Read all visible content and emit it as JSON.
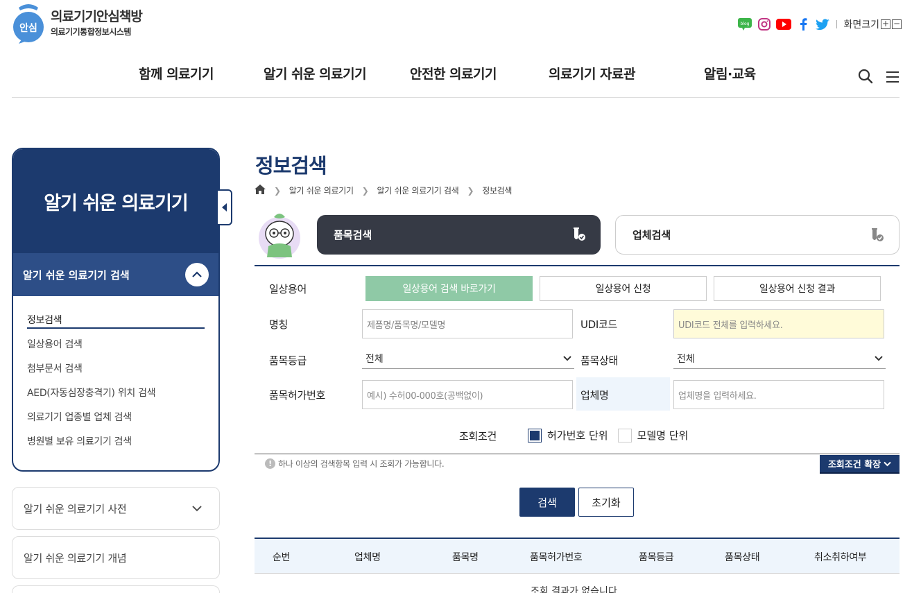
{
  "brand": {
    "title": "의료기기안심책방",
    "subtitle": "의료기기통합정보시스템",
    "logo_mark": "안심"
  },
  "social": {
    "blog_label": "blog",
    "font_size_label": "화면크기",
    "plus": "+",
    "minus": "−"
  },
  "gnb": [
    "함께 의료기기",
    "알기 쉬운 의료기기",
    "안전한 의료기기",
    "의료기기 자료관",
    "알림·교육"
  ],
  "sidebar": {
    "header": "알기 쉬운 의료기기",
    "section": "알기 쉬운 의료기기 검색",
    "items": [
      "정보검색",
      "일상용어 검색",
      "첨부문서 검색",
      "AED(자동심장충격기) 위치 검색",
      "의료기기 업종별 업체 검색",
      "병원별 보유 의료기기 검색"
    ],
    "accordions": [
      "알기 쉬운 의료기기 사전",
      "알기 쉬운 의료기기 개념"
    ]
  },
  "main": {
    "title": "정보검색",
    "breadcrumb": [
      "알기 쉬운 의료기기",
      "알기 쉬운 의료기기 검색",
      "정보검색"
    ],
    "tabs": {
      "product": "품목검색",
      "company": "업체검색"
    }
  },
  "form": {
    "daily_term_label": "일상용어",
    "daily_buttons": [
      "일상용어 검색 바로가기",
      "일상용어 신청",
      "일상용어 신청 결과"
    ],
    "name_label": "명칭",
    "name_placeholder": "제품명/품목명/모델명",
    "udi_label": "UDI코드",
    "udi_placeholder": "UDI코드 전체를 입력하세요.",
    "grade_label": "품목등급",
    "grade_value": "전체",
    "status_label": "품목상태",
    "status_value": "전체",
    "permit_label": "품목허가번호",
    "permit_placeholder": "예시) 수허00-000호(공백없이)",
    "company_label": "업체명",
    "company_placeholder": "업체명을 입력하세요.",
    "condition_label": "조회조건",
    "condition_options": [
      "허가번호 단위",
      "모델명 단위"
    ],
    "notice": "하나 이상의 검색항목 입력 시 조회가 가능합니다.",
    "expand_label": "조회조건 확장",
    "search_label": "검색",
    "reset_label": "초기화"
  },
  "table": {
    "headers": [
      "순번",
      "업체명",
      "품목명",
      "품목허가번호",
      "품목등급",
      "품목상태",
      "취소취하여부"
    ],
    "empty_message": "조회 결과가 없습니다."
  },
  "colors": {
    "navy": "#1c3a6e",
    "tab_dark": "#363a45",
    "green_button": "#8fc9a6",
    "udi_bg": "#fffbd9",
    "table_head_bg": "#eef5fc"
  }
}
